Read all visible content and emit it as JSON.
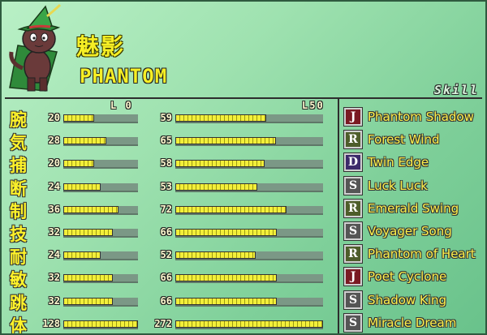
{
  "character": {
    "name_jp": "魅影",
    "name_en": "PHANTOM"
  },
  "skill_header": "Skill",
  "level_labels": {
    "min": "L 0",
    "max": "L50"
  },
  "stats": [
    {
      "kanji": "腕",
      "base": "20",
      "base_val": 20,
      "max": "59",
      "max_val": 59
    },
    {
      "kanji": "気",
      "base": "28",
      "base_val": 28,
      "max": "65",
      "max_val": 65
    },
    {
      "kanji": "捕",
      "base": "20",
      "base_val": 20,
      "max": "58",
      "max_val": 58
    },
    {
      "kanji": "断",
      "base": "24",
      "base_val": 24,
      "max": "53",
      "max_val": 53
    },
    {
      "kanji": "制",
      "base": "36",
      "base_val": 36,
      "max": "72",
      "max_val": 72
    },
    {
      "kanji": "技",
      "base": "32",
      "base_val": 32,
      "max": "66",
      "max_val": 66
    },
    {
      "kanji": "耐",
      "base": "24",
      "base_val": 24,
      "max": "52",
      "max_val": 52
    },
    {
      "kanji": "敏",
      "base": "32",
      "base_val": 32,
      "max": "66",
      "max_val": 66
    },
    {
      "kanji": "跳",
      "base": "32",
      "base_val": 32,
      "max": "66",
      "max_val": 66
    },
    {
      "kanji": "体",
      "base": "128",
      "base_val": 128,
      "max": "272",
      "max_val": 272
    }
  ],
  "skills": [
    {
      "type": "J",
      "name": "Phantom Shadow",
      "color": "#7a1a22"
    },
    {
      "type": "R",
      "name": "Forest Wind",
      "color": "#4e5d2a"
    },
    {
      "type": "D",
      "name": "Twin Edge",
      "color": "#3c2a6a"
    },
    {
      "type": "S",
      "name": "Luck Luck",
      "color": "#555555"
    },
    {
      "type": "R",
      "name": "Emerald Swing",
      "color": "#4e5d2a"
    },
    {
      "type": "S",
      "name": "Voyager Song",
      "color": "#555555"
    },
    {
      "type": "R",
      "name": "Phantom of Heart",
      "color": "#4e5d2a"
    },
    {
      "type": "J",
      "name": "Poet Cyclone",
      "color": "#7a1a22"
    },
    {
      "type": "S",
      "name": "Shadow King",
      "color": "#555555"
    },
    {
      "type": "S",
      "name": "Miracle Dream",
      "color": "#555555"
    }
  ]
}
